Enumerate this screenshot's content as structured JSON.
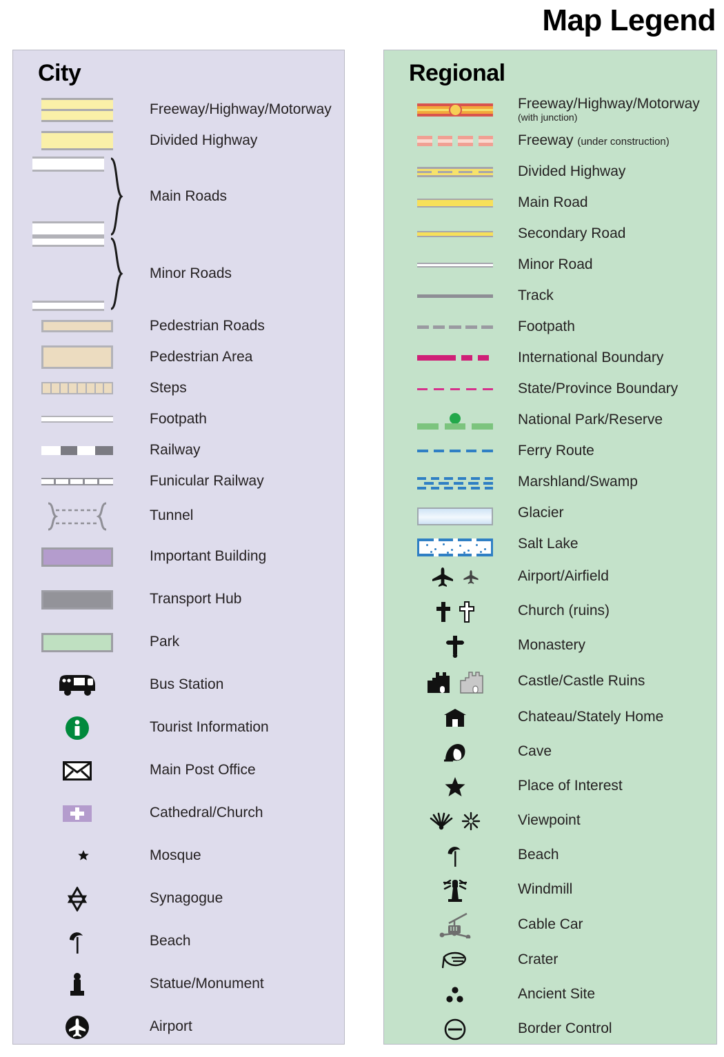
{
  "title": "Map Legend",
  "panels": {
    "city": {
      "heading": "City",
      "background": "#dedcec",
      "items": [
        {
          "label": "Freeway/Highway/Motorway",
          "symbol": "freeway-swatch"
        },
        {
          "label": "Divided Highway",
          "symbol": "divided-highway-swatch"
        },
        {
          "label": "Main Roads",
          "symbol": "main-roads-pair-swatch"
        },
        {
          "label": "Minor Roads",
          "symbol": "minor-roads-pair-swatch"
        },
        {
          "label": "Pedestrian Roads",
          "symbol": "pedestrian-road-swatch"
        },
        {
          "label": "Pedestrian Area",
          "symbol": "pedestrian-area-swatch"
        },
        {
          "label": "Steps",
          "symbol": "steps-swatch"
        },
        {
          "label": "Footpath",
          "symbol": "footpath-swatch"
        },
        {
          "label": "Railway",
          "symbol": "railway-swatch"
        },
        {
          "label": "Funicular Railway",
          "symbol": "funicular-railway-swatch"
        },
        {
          "label": "Tunnel",
          "symbol": "tunnel-swatch"
        },
        {
          "label": "Important Building",
          "symbol": "important-building-swatch"
        },
        {
          "label": "Transport Hub",
          "symbol": "transport-hub-swatch"
        },
        {
          "label": "Park",
          "symbol": "park-swatch"
        },
        {
          "label": "Bus Station",
          "symbol": "bus-icon"
        },
        {
          "label": "Tourist Information",
          "symbol": "information-icon"
        },
        {
          "label": "Main Post Office",
          "symbol": "envelope-icon"
        },
        {
          "label": "Cathedral/Church",
          "symbol": "church-cross-icon"
        },
        {
          "label": "Mosque",
          "symbol": "crescent-star-icon"
        },
        {
          "label": "Synagogue",
          "symbol": "star-of-david-icon"
        },
        {
          "label": "Beach",
          "symbol": "beach-umbrella-icon"
        },
        {
          "label": "Statue/Monument",
          "symbol": "statue-icon"
        },
        {
          "label": "Airport",
          "symbol": "airport-circle-icon"
        }
      ]
    },
    "regional": {
      "heading": "Regional",
      "background": "#c4e2ca",
      "items": [
        {
          "label": "Freeway/Highway/Motorway",
          "sublabel": "(with junction)",
          "sublabel_style": "block",
          "symbol": "freeway-junction-line"
        },
        {
          "label": "Freeway",
          "sublabel": "(under construction)",
          "sublabel_style": "inline",
          "symbol": "freeway-construction-line"
        },
        {
          "label": "Divided Highway",
          "symbol": "divided-highway-line"
        },
        {
          "label": "Main Road",
          "symbol": "main-road-line"
        },
        {
          "label": "Secondary Road",
          "symbol": "secondary-road-line"
        },
        {
          "label": "Minor Road",
          "symbol": "minor-road-line"
        },
        {
          "label": "Track",
          "symbol": "track-line"
        },
        {
          "label": "Footpath",
          "symbol": "footpath-dashed-line"
        },
        {
          "label": "International Boundary",
          "symbol": "international-boundary-line"
        },
        {
          "label": "State/Province Boundary",
          "symbol": "state-boundary-line"
        },
        {
          "label": "National Park/Reserve",
          "symbol": "national-park-line"
        },
        {
          "label": "Ferry Route",
          "symbol": "ferry-route-line"
        },
        {
          "label": "Marshland/Swamp",
          "symbol": "marshland-pattern"
        },
        {
          "label": "Glacier",
          "symbol": "glacier-swatch"
        },
        {
          "label": "Salt Lake",
          "symbol": "salt-lake-swatch"
        },
        {
          "label": "Airport/Airfield",
          "symbol": "airplane-icons"
        },
        {
          "label": "Church (ruins)",
          "symbol": "church-ruins-icons"
        },
        {
          "label": "Monastery",
          "symbol": "monastery-cross-icon"
        },
        {
          "label": "Castle/Castle Ruins",
          "symbol": "castle-icons"
        },
        {
          "label": "Chateau/Stately Home",
          "symbol": "chateau-icon"
        },
        {
          "label": "Cave",
          "symbol": "cave-icon"
        },
        {
          "label": "Place of Interest",
          "symbol": "star-icon"
        },
        {
          "label": "Viewpoint",
          "symbol": "viewpoint-icons"
        },
        {
          "label": "Beach",
          "symbol": "beach-umbrella-icon"
        },
        {
          "label": "Windmill",
          "symbol": "windmill-icon"
        },
        {
          "label": "Cable Car",
          "symbol": "cable-car-icon"
        },
        {
          "label": "Crater",
          "symbol": "crater-icon"
        },
        {
          "label": "Ancient Site",
          "symbol": "ancient-site-icon"
        },
        {
          "label": "Border Control",
          "symbol": "border-control-icon"
        }
      ]
    }
  },
  "colors": {
    "city_panel_bg": "#dedcec",
    "regional_panel_bg": "#c4e2ca",
    "freeway_yellow": "#faf0a8",
    "road_casing_gray": "#a9a9ae",
    "pedestrian_tan": "#ecdcc0",
    "important_building_purple": "#b49ccd",
    "transport_hub_gray": "#939399",
    "park_green": "#bfe0c1",
    "regional_freeway_red": "#d9544d",
    "regional_freeway_orange": "#f2a83c",
    "regional_road_yellow": "#f7e05a",
    "international_boundary_pink": "#cf2077",
    "state_boundary_pink": "#d6308b",
    "national_park_green": "#7cc47e",
    "national_park_dot_green": "#22a84a",
    "ferry_blue": "#2f7fc4",
    "tourist_info_green": "#00893c"
  }
}
